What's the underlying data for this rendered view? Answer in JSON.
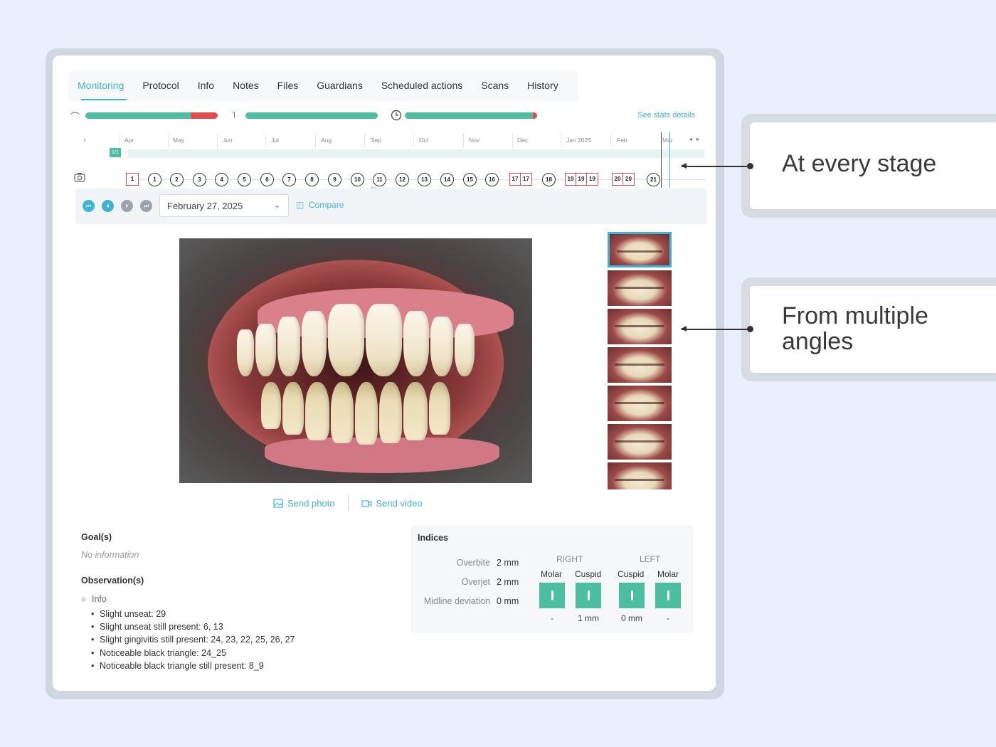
{
  "tabs": [
    "Monitoring",
    "Protocol",
    "Info",
    "Notes",
    "Files",
    "Guardians",
    "Scheduled actions",
    "Scans",
    "History"
  ],
  "active_tab": "Monitoring",
  "stats": {
    "see_stats_link": "See stats details",
    "aligner_wear_progress": 0.85,
    "elastics_progress": 1.0,
    "time_progress": 0.98
  },
  "timeline": {
    "months": [
      "r",
      "Apr",
      "May",
      "Jun",
      "Jul",
      "Aug",
      "Sep",
      "Oct",
      "Nov",
      "Dec",
      "Jan 2025",
      "Feb",
      "Mar"
    ],
    "track_label": "1/1",
    "stages_first": "1",
    "stages": [
      "1",
      "2",
      "3",
      "4",
      "5",
      "6",
      "7",
      "8",
      "9",
      "10",
      "11",
      "12",
      "13",
      "14",
      "15",
      "16"
    ],
    "group_17": [
      "17",
      "17"
    ],
    "stage_18": "18",
    "group_19": [
      "19",
      "19",
      "19"
    ],
    "group_20": [
      "20",
      "20"
    ],
    "stage_21": "21",
    "show_more": "Show more"
  },
  "toolbar": {
    "date": "February 27, 2025",
    "compare": "Compare"
  },
  "send": {
    "photo": "Send photo",
    "video": "Send video"
  },
  "goals": {
    "title": "Goal(s)",
    "value": "No information"
  },
  "observations": {
    "title": "Observation(s)",
    "group": "Info",
    "items": [
      "Slight unseat: 29",
      "Slight unseat still present: 6, 13",
      "Slight gingivitis still present: 24, 23, 22, 25, 26, 27",
      "Noticeable black triangle: 24_25",
      "Noticeable black triangle still present: 8_9"
    ]
  },
  "indices": {
    "title": "Indices",
    "overbite_label": "Overbite",
    "overbite_value": "2 mm",
    "overjet_label": "Overjet",
    "overjet_value": "2 mm",
    "midline_label": "Midline deviation",
    "midline_value": "0 mm",
    "right": "RIGHT",
    "left": "LEFT",
    "cols": [
      "Molar",
      "Cuspid",
      "Cuspid",
      "Molar"
    ],
    "vals": [
      "-",
      "1 mm",
      "0 mm",
      "-"
    ]
  },
  "callouts": {
    "stage": "At every stage",
    "angles_line1": "From multiple",
    "angles_line2": "angles"
  },
  "colors": {
    "accent": "#3fb3d4",
    "progress": "#4cbfa0",
    "alert": "#e14c4c"
  }
}
